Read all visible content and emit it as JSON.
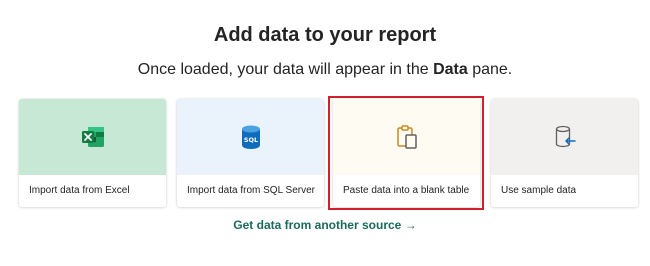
{
  "header": {
    "title": "Add data to your report",
    "subtitle_prefix": "Once loaded, your data will appear in the ",
    "subtitle_bold": "Data",
    "subtitle_suffix": " pane."
  },
  "cards": [
    {
      "label": "Import data from Excel",
      "icon": "excel-icon",
      "bg": "#c8e8d6"
    },
    {
      "label": "Import data from SQL Server",
      "icon": "sql-database-icon",
      "bg": "#eaf3fb"
    },
    {
      "label": "Paste data into a blank table",
      "icon": "paste-clipboard-icon",
      "bg": "#fdfbf2"
    },
    {
      "label": "Use sample data",
      "icon": "sample-data-cylinder-icon",
      "bg": "#f1f0ef"
    }
  ],
  "link": {
    "label": "Get data from another source",
    "arrow": "→"
  },
  "colors": {
    "highlight": "#d0202a",
    "link": "#1a6b5a"
  }
}
